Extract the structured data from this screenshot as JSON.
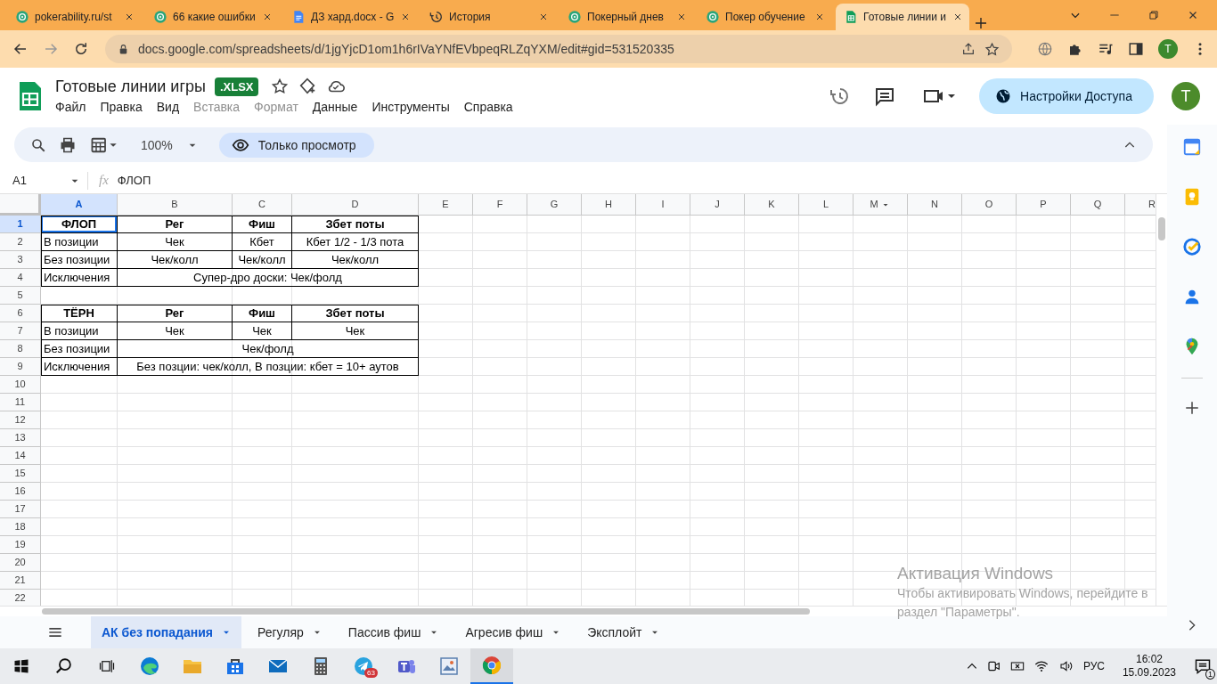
{
  "browser": {
    "tabs": [
      {
        "kind": "site",
        "title": "pokerability.ru/st",
        "selected": false
      },
      {
        "kind": "site",
        "title": "66 какие ошибки",
        "selected": false
      },
      {
        "kind": "docs",
        "title": "ДЗ хард.docx - G",
        "selected": false
      },
      {
        "kind": "history",
        "title": "История",
        "selected": false
      },
      {
        "kind": "site",
        "title": "Покерный днев",
        "selected": false
      },
      {
        "kind": "site",
        "title": "Покер обучение",
        "selected": false
      },
      {
        "kind": "sheets",
        "title": "Готовые линии и",
        "selected": true
      }
    ],
    "address": "docs.google.com/spreadsheets/d/1jgYjcD1om1h6rIVaYNfEVbpeqRLZqYXM/edit#gid=531520335",
    "profile": "T"
  },
  "document": {
    "title": "Готовые линии игры",
    "badge": ".XLSX",
    "menu": [
      {
        "label": "Файл",
        "disabled": false
      },
      {
        "label": "Правка",
        "disabled": false
      },
      {
        "label": "Вид",
        "disabled": false
      },
      {
        "label": "Вставка",
        "disabled": true
      },
      {
        "label": "Формат",
        "disabled": true
      },
      {
        "label": "Данные",
        "disabled": false
      },
      {
        "label": "Инструменты",
        "disabled": false
      },
      {
        "label": "Справка",
        "disabled": false
      }
    ],
    "share": "Настройки Доступа",
    "avatar": "T"
  },
  "toolbar": {
    "zoom": "100%",
    "mode": "Только просмотр"
  },
  "formula_bar": {
    "cell": "A1",
    "fx_label": "fx",
    "content": "ФЛОП"
  },
  "sheet": {
    "columns": [
      {
        "label": "A",
        "selected": true,
        "dropdown": false
      },
      {
        "label": "B",
        "selected": false,
        "dropdown": false
      },
      {
        "label": "C",
        "selected": false,
        "dropdown": false
      },
      {
        "label": "D",
        "selected": false,
        "dropdown": false
      },
      {
        "label": "E",
        "selected": false,
        "dropdown": false
      },
      {
        "label": "F",
        "selected": false,
        "dropdown": false
      },
      {
        "label": "G",
        "selected": false,
        "dropdown": false
      },
      {
        "label": "H",
        "selected": false,
        "dropdown": false
      },
      {
        "label": "I",
        "selected": false,
        "dropdown": false
      },
      {
        "label": "J",
        "selected": false,
        "dropdown": false
      },
      {
        "label": "K",
        "selected": false,
        "dropdown": false
      },
      {
        "label": "L",
        "selected": false,
        "dropdown": false
      },
      {
        "label": "M",
        "selected": false,
        "dropdown": true
      },
      {
        "label": "N",
        "selected": false,
        "dropdown": false
      },
      {
        "label": "O",
        "selected": false,
        "dropdown": false
      },
      {
        "label": "P",
        "selected": false,
        "dropdown": false
      },
      {
        "label": "Q",
        "selected": false,
        "dropdown": false
      },
      {
        "label": "R",
        "selected": false,
        "dropdown": false
      }
    ],
    "rows": [
      {
        "label": "1",
        "selected": true,
        "cells": [
          {
            "kind": "cell",
            "text": "ФЛОП",
            "bold": true,
            "selected": true
          },
          {
            "kind": "cell",
            "text": "Рег",
            "bold": true,
            "selected": false
          },
          {
            "kind": "cell",
            "text": "Фиш",
            "bold": true,
            "selected": false
          },
          {
            "kind": "cell",
            "text": "Збет поты",
            "bold": true,
            "selected": false
          }
        ]
      },
      {
        "label": "2",
        "selected": false,
        "cells": [
          {
            "kind": "cell",
            "text": "В позиции",
            "bold": false,
            "selected": false
          },
          {
            "kind": "cell",
            "text": "Чек",
            "bold": false,
            "selected": false
          },
          {
            "kind": "cell",
            "text": "Кбет",
            "bold": false,
            "selected": false
          },
          {
            "kind": "cell",
            "text": "Кбет 1/2 - 1/3 пота",
            "bold": false,
            "selected": false
          }
        ]
      },
      {
        "label": "3",
        "selected": false,
        "cells": [
          {
            "kind": "cell",
            "text": "Без позиции",
            "bold": false,
            "selected": false
          },
          {
            "kind": "cell",
            "text": "Чек/колл",
            "bold": false,
            "selected": false
          },
          {
            "kind": "cell",
            "text": "Чек/колл",
            "bold": false,
            "selected": false
          },
          {
            "kind": "cell",
            "text": "Чек/колл",
            "bold": false,
            "selected": false
          }
        ]
      },
      {
        "label": "4",
        "selected": false,
        "cells": [
          {
            "kind": "cell",
            "text": "Исключения",
            "bold": false,
            "selected": false
          },
          {
            "kind": "merged",
            "text": "Супер-дро доски: Чек/фолд",
            "bold": false,
            "selected": false
          }
        ]
      },
      {
        "label": "5",
        "selected": false
      },
      {
        "label": "6",
        "selected": false,
        "cells": [
          {
            "kind": "cell",
            "text": "ТЁРН",
            "bold": true,
            "selected": false
          },
          {
            "kind": "cell",
            "text": "Рег",
            "bold": true,
            "selected": false
          },
          {
            "kind": "cell",
            "text": "Фиш",
            "bold": true,
            "selected": false
          },
          {
            "kind": "cell",
            "text": "Збет поты",
            "bold": true,
            "selected": false
          }
        ]
      },
      {
        "label": "7",
        "selected": false,
        "cells": [
          {
            "kind": "cell",
            "text": "В позиции",
            "bold": false,
            "selected": false
          },
          {
            "kind": "cell",
            "text": "Чек",
            "bold": false,
            "selected": false
          },
          {
            "kind": "cell",
            "text": "Чек",
            "bold": false,
            "selected": false
          },
          {
            "kind": "cell",
            "text": "Чек",
            "bold": false,
            "selected": false
          }
        ]
      },
      {
        "label": "8",
        "selected": false,
        "cells": [
          {
            "kind": "cell",
            "text": "Без позиции",
            "bold": false,
            "selected": false
          },
          {
            "kind": "merged",
            "text": "Чек/фолд",
            "bold": false,
            "selected": false
          }
        ]
      },
      {
        "label": "9",
        "selected": false,
        "cells": [
          {
            "kind": "cell",
            "text": "Исключения",
            "bold": false,
            "selected": false
          },
          {
            "kind": "merged",
            "text": "Без позции: чек/колл, В позции: кбет = 10+ аутов",
            "bold": false,
            "selected": false
          }
        ]
      },
      {
        "label": "10",
        "selected": false
      },
      {
        "label": "11",
        "selected": false
      },
      {
        "label": "12",
        "selected": false
      },
      {
        "label": "13",
        "selected": false
      },
      {
        "label": "14",
        "selected": false
      },
      {
        "label": "15",
        "selected": false
      },
      {
        "label": "16",
        "selected": false
      },
      {
        "label": "17",
        "selected": false
      },
      {
        "label": "18",
        "selected": false
      },
      {
        "label": "19",
        "selected": false
      },
      {
        "label": "20",
        "selected": false
      },
      {
        "label": "21",
        "selected": false
      },
      {
        "label": "22",
        "selected": false
      }
    ]
  },
  "sheet_tabs": [
    {
      "label": "АК без попадания",
      "selected": true
    },
    {
      "label": "Регуляр",
      "selected": false
    },
    {
      "label": "Пассив фиш",
      "selected": false
    },
    {
      "label": "Агресив фиш",
      "selected": false
    },
    {
      "label": "Эксплойт",
      "selected": false
    }
  ],
  "activation": {
    "title": "Активация Windows",
    "line_1": "Чтобы активировать Windows, перейдите в",
    "line_2": "раздел \"Параметры\"."
  },
  "taskbar": {
    "apps": [
      {
        "kind": "edge",
        "active": false
      },
      {
        "kind": "explorer",
        "active": false
      },
      {
        "kind": "store",
        "active": false
      },
      {
        "kind": "mail",
        "active": false
      },
      {
        "kind": "calculator",
        "active": false
      },
      {
        "kind": "telegram",
        "active": false,
        "badge": "63"
      },
      {
        "kind": "teams",
        "active": false
      },
      {
        "kind": "viewer",
        "active": false
      },
      {
        "kind": "chrome",
        "active": true
      }
    ],
    "language": "РУС",
    "time": "16:02",
    "date": "15.09.2023",
    "notifications": "1"
  }
}
